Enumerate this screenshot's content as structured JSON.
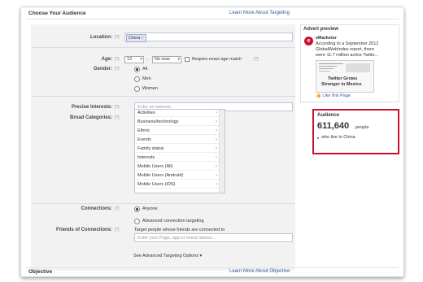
{
  "header": {
    "title": "Choose Your Audience",
    "learn_more": "Learn More About Targeting"
  },
  "location": {
    "label": "Location:",
    "help": "[?]",
    "token": "China",
    "token_remove": "×"
  },
  "age": {
    "label": "Age:",
    "help": "[?]",
    "min": "13",
    "sep": "-",
    "max": "No max",
    "exact_label": "Require exact age match",
    "help2": "[?]"
  },
  "gender": {
    "label": "Gender:",
    "help": "[?]",
    "options": [
      "All",
      "Men",
      "Women"
    ],
    "selected": "All"
  },
  "precise": {
    "label": "Precise Interests:",
    "help": "[?]",
    "placeholder": "Enter an interest..."
  },
  "broad": {
    "label": "Broad Categories:",
    "help": "[?]",
    "items": [
      "Activities",
      "Business/technology",
      "Ethnic",
      "Events",
      "Family status",
      "Interests",
      "Mobile Users (All)",
      "Mobile Users (Android)",
      "Mobile Users (iOS)"
    ]
  },
  "connections": {
    "label": "Connections:",
    "help": "[?]",
    "anyone": "Anyone",
    "advanced": "Advanced connection targeting"
  },
  "friends": {
    "label": "Friends of Connections:",
    "help": "[?]",
    "desc": "Target people whose friends are connected to",
    "placeholder": "Enter your Page, app or event names..."
  },
  "advanced_link": "See Advanced Targeting Options ▾",
  "objective": {
    "title": "Objective",
    "learn_more": "Learn More About Objective"
  },
  "advert": {
    "heading": "Advert preview",
    "brand": "eMarketer",
    "text": [
      "According to a September 2012",
      "GlobalWebIndex report, there",
      "were 11.7 million active Twitte..."
    ],
    "link_title": [
      "Twitter Grows",
      "Stronger in Mexico"
    ],
    "like": "Like this Page"
  },
  "audience": {
    "heading": "Audience",
    "count": "611,640",
    "unit": "people",
    "desc": "who live in China"
  },
  "colors": {
    "link": "#3b5998",
    "highlight": "#c8102e",
    "panel": "#f2f2f2"
  }
}
